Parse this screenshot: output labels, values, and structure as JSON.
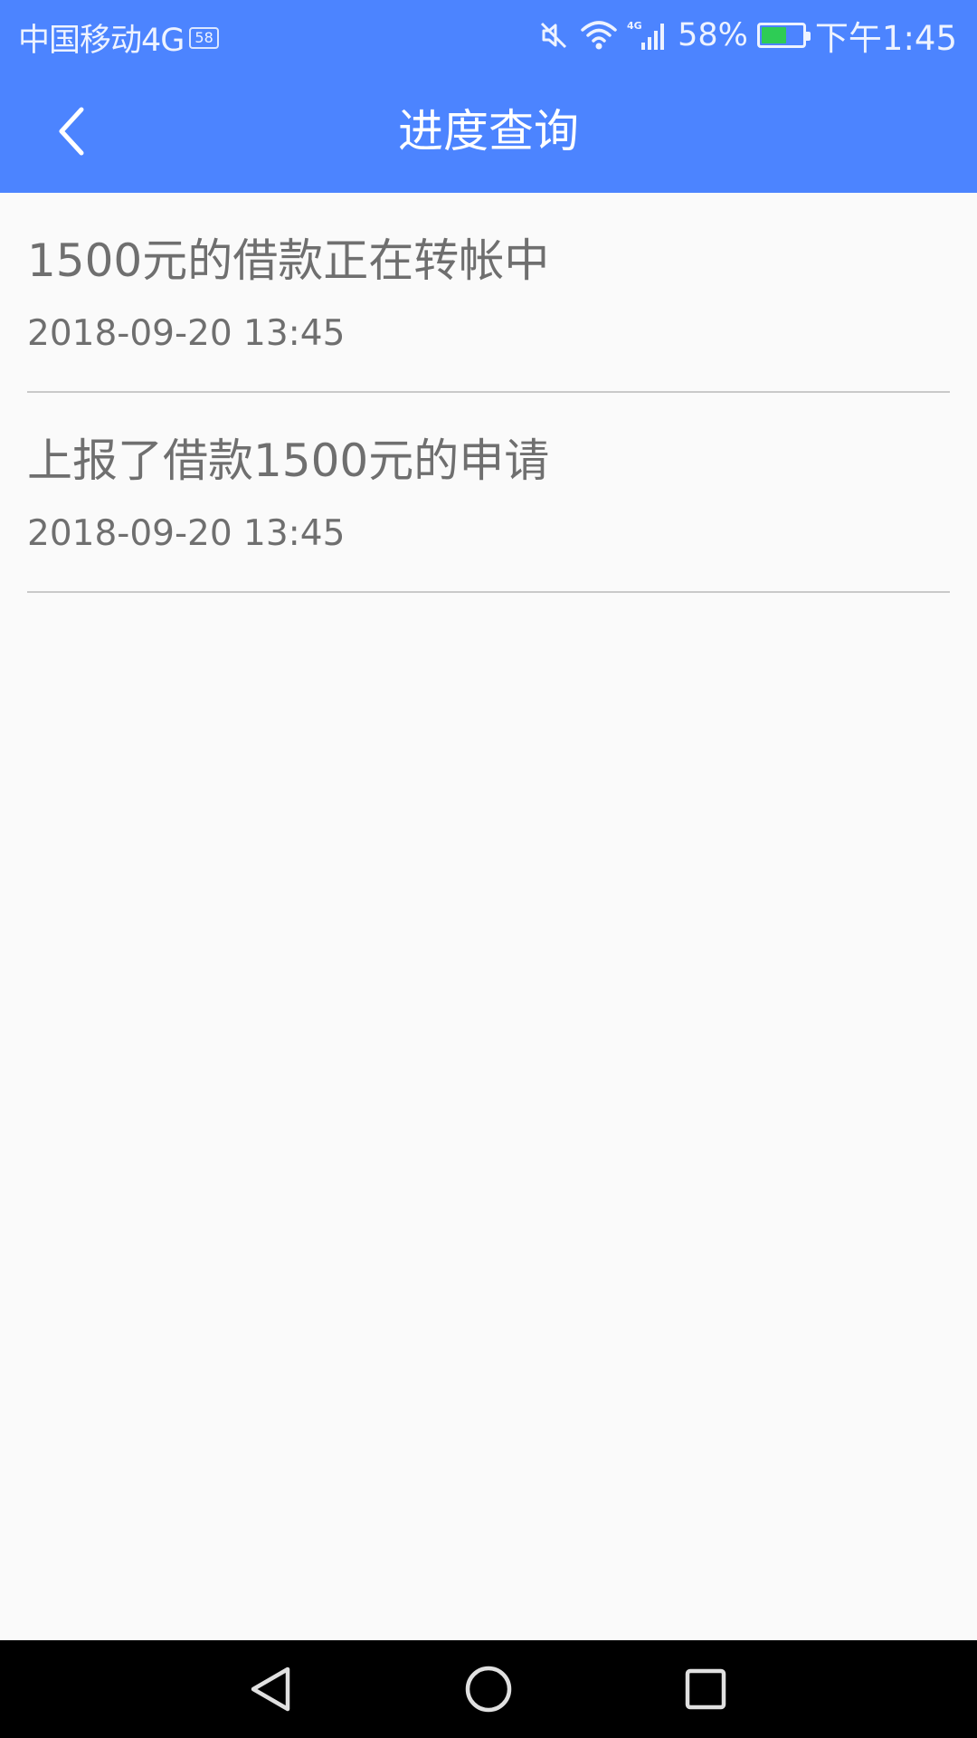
{
  "status_bar": {
    "carrier": "中国移动4G",
    "sim_badge": "58",
    "network_label": "4G",
    "battery_percent": "58%",
    "time": "下午1:45",
    "icons": [
      "mute-icon",
      "wifi-icon",
      "signal-icon",
      "battery-charging-icon"
    ]
  },
  "header": {
    "title": "进度查询",
    "back_icon": "chevron-left-icon",
    "color": "#4c84ff"
  },
  "progress_items": [
    {
      "text": "1500元的借款正在转帐中",
      "time": "2018-09-20 13:45"
    },
    {
      "text": "上报了借款1500元的申请",
      "time": "2018-09-20 13:45"
    }
  ],
  "system_nav": {
    "icons": [
      "back-triangle-icon",
      "home-circle-icon",
      "recents-square-icon"
    ]
  }
}
